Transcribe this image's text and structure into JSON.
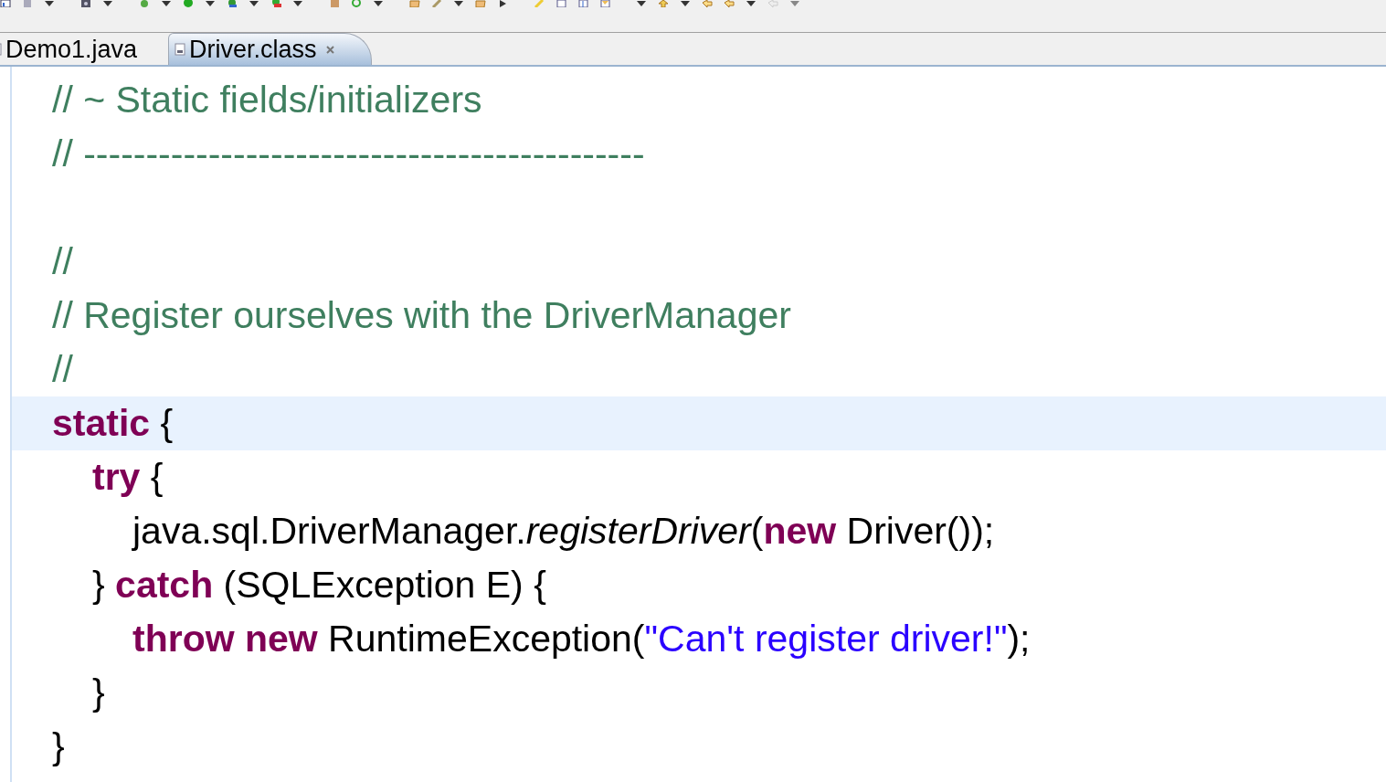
{
  "tabs": [
    {
      "label": "Demo1.java",
      "selected": false,
      "closable": false
    },
    {
      "label": "Driver.class",
      "selected": true,
      "closable": true
    }
  ],
  "editor": {
    "lines": [
      {
        "current": false,
        "tokens": [
          {
            "kind": "comment",
            "text": "// ~ Static fields/initializers"
          }
        ]
      },
      {
        "current": false,
        "tokens": [
          {
            "kind": "comment",
            "text": "// ---------------------------------------------"
          }
        ]
      },
      {
        "current": false
      },
      {
        "current": false,
        "tokens": [
          {
            "kind": "comment",
            "text": "//"
          }
        ]
      },
      {
        "current": false,
        "tokens": [
          {
            "kind": "comment",
            "text": "// Register ourselves with the DriverManager"
          }
        ]
      },
      {
        "current": false,
        "tokens": [
          {
            "kind": "comment",
            "text": "//"
          }
        ]
      },
      {
        "current": true,
        "tokens": [
          {
            "kind": "keyword",
            "text": "static"
          },
          {
            "kind": "plain",
            "text": " {"
          }
        ],
        "children": [
          {
            "current": false,
            "tokens": [
              {
                "kind": "keyword",
                "text": "try"
              },
              {
                "kind": "plain",
                "text": " {"
              }
            ],
            "children": [
              {
                "current": false,
                "tokens": [
                  {
                    "kind": "plain",
                    "text": "java.sql.DriverManager."
                  },
                  {
                    "kind": "method",
                    "text": "registerDriver"
                  },
                  {
                    "kind": "plain",
                    "text": "("
                  },
                  {
                    "kind": "keyword",
                    "text": "new"
                  },
                  {
                    "kind": "plain",
                    "text": " Driver());"
                  }
                ]
              }
            ]
          },
          {
            "current": false,
            "tokens": [
              {
                "kind": "plain",
                "text": "} "
              },
              {
                "kind": "keyword",
                "text": "catch"
              },
              {
                "kind": "plain",
                "text": " (SQLException E) {"
              }
            ],
            "children": [
              {
                "current": false,
                "tokens": [
                  {
                    "kind": "keyword",
                    "text": "throw new"
                  },
                  {
                    "kind": "plain",
                    "text": " RuntimeException("
                  },
                  {
                    "kind": "string",
                    "text": "\"Can't register driver!\""
                  },
                  {
                    "kind": "plain",
                    "text": ");"
                  }
                ]
              }
            ]
          },
          {
            "current": false,
            "tokens": [
              {
                "kind": "plain",
                "text": "}"
              }
            ]
          }
        ]
      },
      {
        "current": false,
        "tokens": [
          {
            "kind": "plain",
            "text": "}"
          }
        ]
      }
    ]
  }
}
